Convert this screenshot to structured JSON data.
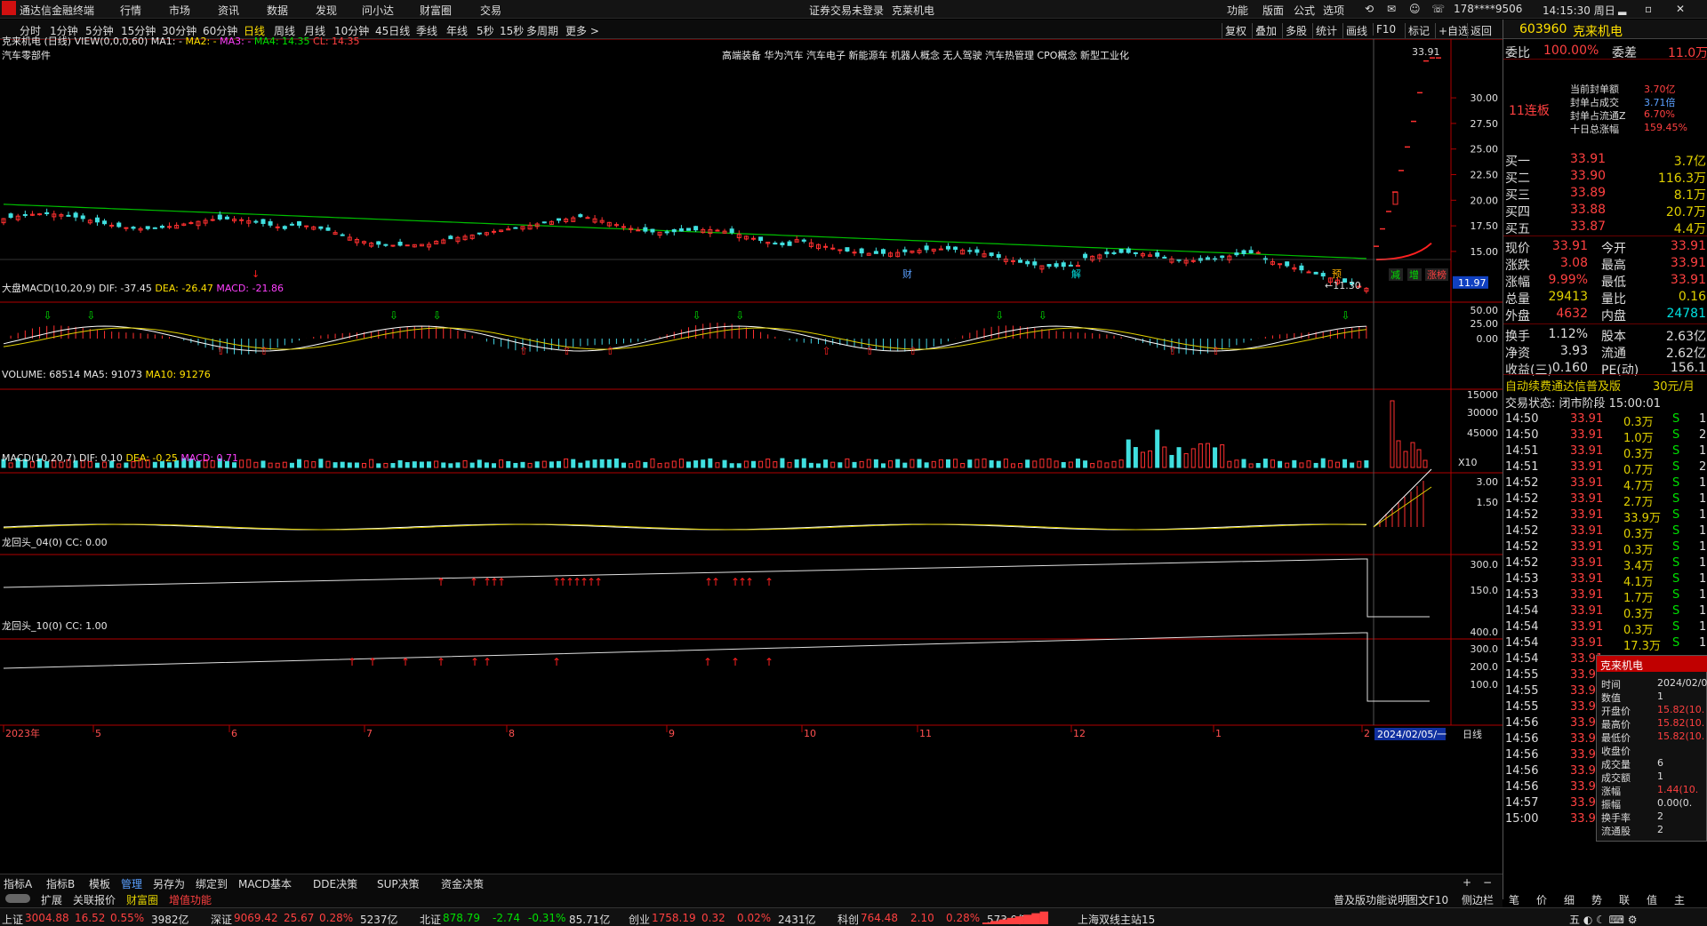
{
  "app": {
    "name": "通达信金融终端",
    "menu": [
      "行情",
      "市场",
      "资讯",
      "数据",
      "发现",
      "问小达",
      "财富圈",
      "交易"
    ],
    "warning": "证券交易未登录",
    "stock_short": "克莱机电",
    "right_menu": [
      "功能",
      "版面",
      "公式",
      "选项"
    ],
    "account": "178****9506",
    "clock": "14:15:30 周日"
  },
  "toolbar": {
    "periods": [
      "分时",
      "1分钟",
      "5分钟",
      "15分钟",
      "30分钟",
      "60分钟",
      "日线",
      "周线",
      "月线",
      "10分钟",
      "45日线",
      "季线",
      "年线",
      "5秒",
      "15秒",
      "多周期",
      "更多 >"
    ],
    "active": "日线",
    "actions": [
      "复权",
      "叠加",
      "多股",
      "统计",
      "画线",
      "F10",
      "标记",
      "+自选",
      "返回"
    ]
  },
  "main_panel": {
    "title": "克来机电 (日线)",
    "view": "VIEW(0,0,0,60)",
    "ma1": "MA1: -",
    "ma2": "MA2: -",
    "ma3": "MA3: -",
    "ma4": "MA4: 14.35",
    "cl": "CL: 14.35",
    "industry": "汽车零部件",
    "concepts": "高端装备 华为汽车 汽车电子 新能源车 机器人概念 无人驾驶 汽车热管理 CPO概念 新型工业化",
    "high_label": "33.91",
    "low_label": "11.30",
    "price_tag": "11.97",
    "y_ticks": [
      "30.00",
      "27.50",
      "25.00",
      "22.50",
      "20.00",
      "17.50",
      "15.00"
    ],
    "markers": [
      "财",
      "解",
      "预"
    ],
    "tags": [
      "减",
      "增",
      "涨榜"
    ]
  },
  "panel_dapan": {
    "label": "大盘MACD(10,20,9)",
    "dif": "DIF: -37.45",
    "dea": "DEA: -26.47",
    "macd": "MACD: -21.86",
    "y_ticks": [
      "50.00",
      "25.00",
      "0.00"
    ]
  },
  "panel_vol": {
    "label": "VOLUME: 68514",
    "ma5": "MA5: 91073",
    "ma10": "MA10: 91276",
    "y_ticks": [
      "45000",
      "30000",
      "15000"
    ],
    "unit": "X10"
  },
  "panel_macd": {
    "label": "MACD(10,20,7)",
    "dif": "DIF: 0.10",
    "dea": "DEA: -0.25",
    "macd": "MACD: 0.71",
    "y_ticks": [
      "3.00",
      "1.50"
    ]
  },
  "panel_l4": {
    "label": "龙回头_04(0)",
    "cc": "CC: 0.00",
    "y_ticks": [
      "300.0",
      "150.0"
    ]
  },
  "panel_l10": {
    "label": "龙回头_10(0)",
    "cc": "CC: 1.00",
    "y_ticks": [
      "400.0",
      "300.0",
      "200.0",
      "100.0"
    ]
  },
  "xaxis": {
    "labels": [
      "2023年",
      "5",
      "6",
      "7",
      "8",
      "9",
      "10",
      "11",
      "12",
      "1",
      "2"
    ],
    "cursor_date": "2024/02/05/一",
    "right": "日线"
  },
  "bottom_tabs": [
    "指标A",
    "指标B",
    "模板",
    "管理",
    "另存为",
    "绑定到",
    "MACD基本",
    "DDE决策",
    "SUP决策",
    "资金决策"
  ],
  "bottom_tabs2": [
    "扩展",
    "关联报价",
    "财富圈",
    "增值功能"
  ],
  "bottom_tabs2_right": [
    "普及版功能说明",
    "图文F10",
    "侧边栏 <"
  ],
  "quote": {
    "code": "603960",
    "name": "克来机电",
    "weibi_label": "委比",
    "weibi": "100.00%",
    "weicha_label": "委差",
    "weicha": "11.0万",
    "limit_badge": "11连板",
    "limit_info": [
      [
        "当前封单额",
        "3.70亿"
      ],
      [
        "封单占成交",
        "3.71倍"
      ],
      [
        "封单占流通Z",
        "6.70%"
      ],
      [
        "十日总涨幅",
        "159.45%"
      ]
    ],
    "bids": [
      [
        "买一",
        "33.91",
        "3.7亿"
      ],
      [
        "买二",
        "33.90",
        "116.3万"
      ],
      [
        "买三",
        "33.89",
        "8.1万"
      ],
      [
        "买四",
        "33.88",
        "20.7万"
      ],
      [
        "买五",
        "33.87",
        "4.4万"
      ]
    ],
    "stats": [
      [
        "现价",
        "33.91",
        "今开",
        "33.91"
      ],
      [
        "涨跌",
        "3.08",
        "最高",
        "33.91"
      ],
      [
        "涨幅",
        "9.99%",
        "最低",
        "33.91"
      ],
      [
        "总量",
        "29413",
        "量比",
        "0.16"
      ],
      [
        "外盘",
        "4632",
        "内盘",
        "24781"
      ],
      [
        "换手",
        "1.12%",
        "股本",
        "2.63亿"
      ],
      [
        "净资",
        "3.93",
        "流通",
        "2.62亿"
      ],
      [
        "收益(三)",
        "0.160",
        "PE(动)",
        "156.1"
      ]
    ],
    "promo": "自动续费通达信普及版",
    "promo_price": "30元/月",
    "trade_status": "交易状态: 闭市阶段 15:00:01",
    "ticks": [
      [
        "14:50",
        "33.91",
        "0.3万",
        "S",
        "1"
      ],
      [
        "14:50",
        "33.91",
        "1.0万",
        "S",
        "2"
      ],
      [
        "14:51",
        "33.91",
        "0.3万",
        "S",
        "1"
      ],
      [
        "14:51",
        "33.91",
        "0.7万",
        "S",
        "2"
      ],
      [
        "14:52",
        "33.91",
        "4.7万",
        "S",
        "1"
      ],
      [
        "14:52",
        "33.91",
        "2.7万",
        "S",
        "1"
      ],
      [
        "14:52",
        "33.91",
        "33.9万",
        "S",
        "1"
      ],
      [
        "14:52",
        "33.91",
        "0.3万",
        "S",
        "1"
      ],
      [
        "14:52",
        "33.91",
        "0.3万",
        "S",
        "1"
      ],
      [
        "14:52",
        "33.91",
        "3.4万",
        "S",
        "1"
      ],
      [
        "14:53",
        "33.91",
        "4.1万",
        "S",
        "1"
      ],
      [
        "14:53",
        "33.91",
        "1.7万",
        "S",
        "1"
      ],
      [
        "14:54",
        "33.91",
        "0.3万",
        "S",
        "1"
      ],
      [
        "14:54",
        "33.91",
        "0.3万",
        "S",
        "1"
      ],
      [
        "14:54",
        "33.91",
        "17.3万",
        "S",
        "1"
      ],
      [
        "14:54",
        "33.91",
        "",
        "",
        ""
      ],
      [
        "14:55",
        "33.91",
        "",
        "",
        ""
      ],
      [
        "14:55",
        "33.91",
        "",
        "",
        ""
      ],
      [
        "14:55",
        "33.91",
        "",
        "",
        ""
      ],
      [
        "14:56",
        "33.91",
        "",
        "",
        ""
      ],
      [
        "14:56",
        "33.91",
        "",
        "",
        ""
      ],
      [
        "14:56",
        "33.91",
        "",
        "",
        ""
      ],
      [
        "14:56",
        "33.91",
        "",
        "",
        ""
      ],
      [
        "14:56",
        "33.91",
        "",
        "",
        ""
      ],
      [
        "14:57",
        "33.91",
        "0.3万",
        "S",
        "1"
      ],
      [
        "15:00",
        "33.91",
        "20.7万",
        "S",
        "16"
      ]
    ],
    "bottom_icons": [
      "笔",
      "价",
      "细",
      "势",
      "联",
      "值",
      "主"
    ]
  },
  "popup": {
    "title": "克来机电",
    "rows": [
      [
        "时间",
        "2024/02/0"
      ],
      [
        "数值",
        "1"
      ],
      [
        "开盘价",
        "15.82(10."
      ],
      [
        "最高价",
        "15.82(10."
      ],
      [
        "最低价",
        "15.82(10."
      ],
      [
        "收盘价",
        ""
      ],
      [
        "成交量",
        "6"
      ],
      [
        "成交额",
        "1"
      ],
      [
        "涨幅",
        "1.44(10."
      ],
      [
        "振幅",
        "0.00(0."
      ],
      [
        "换手率",
        "2"
      ],
      [
        "流通股",
        "2"
      ]
    ]
  },
  "status": {
    "items": [
      [
        "上证",
        "3004.88",
        "16.52",
        "0.55%",
        "3982亿"
      ],
      [
        "深证",
        "9069.42",
        "25.67",
        "0.28%",
        "5237亿"
      ],
      [
        "北证",
        "878.79",
        "-2.74",
        "-0.31%",
        "85.71亿"
      ],
      [
        "创业",
        "1758.19",
        "0.32",
        "0.02%",
        "2431亿"
      ],
      [
        "科创",
        "764.48",
        "2.10",
        "0.28%",
        "573.9亿"
      ]
    ],
    "server": "上海双线主站15"
  },
  "chart_data": {
    "type": "candlestick",
    "note_series": "daily",
    "x_labels": [
      "2023年",
      "5",
      "6",
      "7",
      "8",
      "9",
      "10",
      "11",
      "12",
      "1",
      "2"
    ],
    "last_close": 33.91,
    "low": 11.3,
    "high": 33.91,
    "ma4": 14.35
  }
}
